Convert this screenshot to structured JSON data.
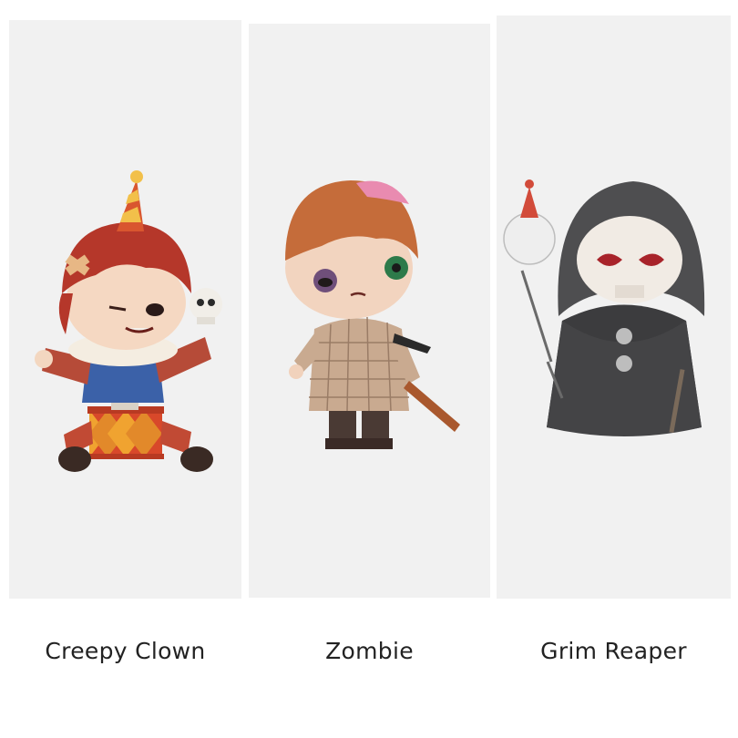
{
  "figures": [
    {
      "name": "Creepy Clown"
    },
    {
      "name": "Zombie"
    },
    {
      "name": "Grim Reaper"
    }
  ]
}
